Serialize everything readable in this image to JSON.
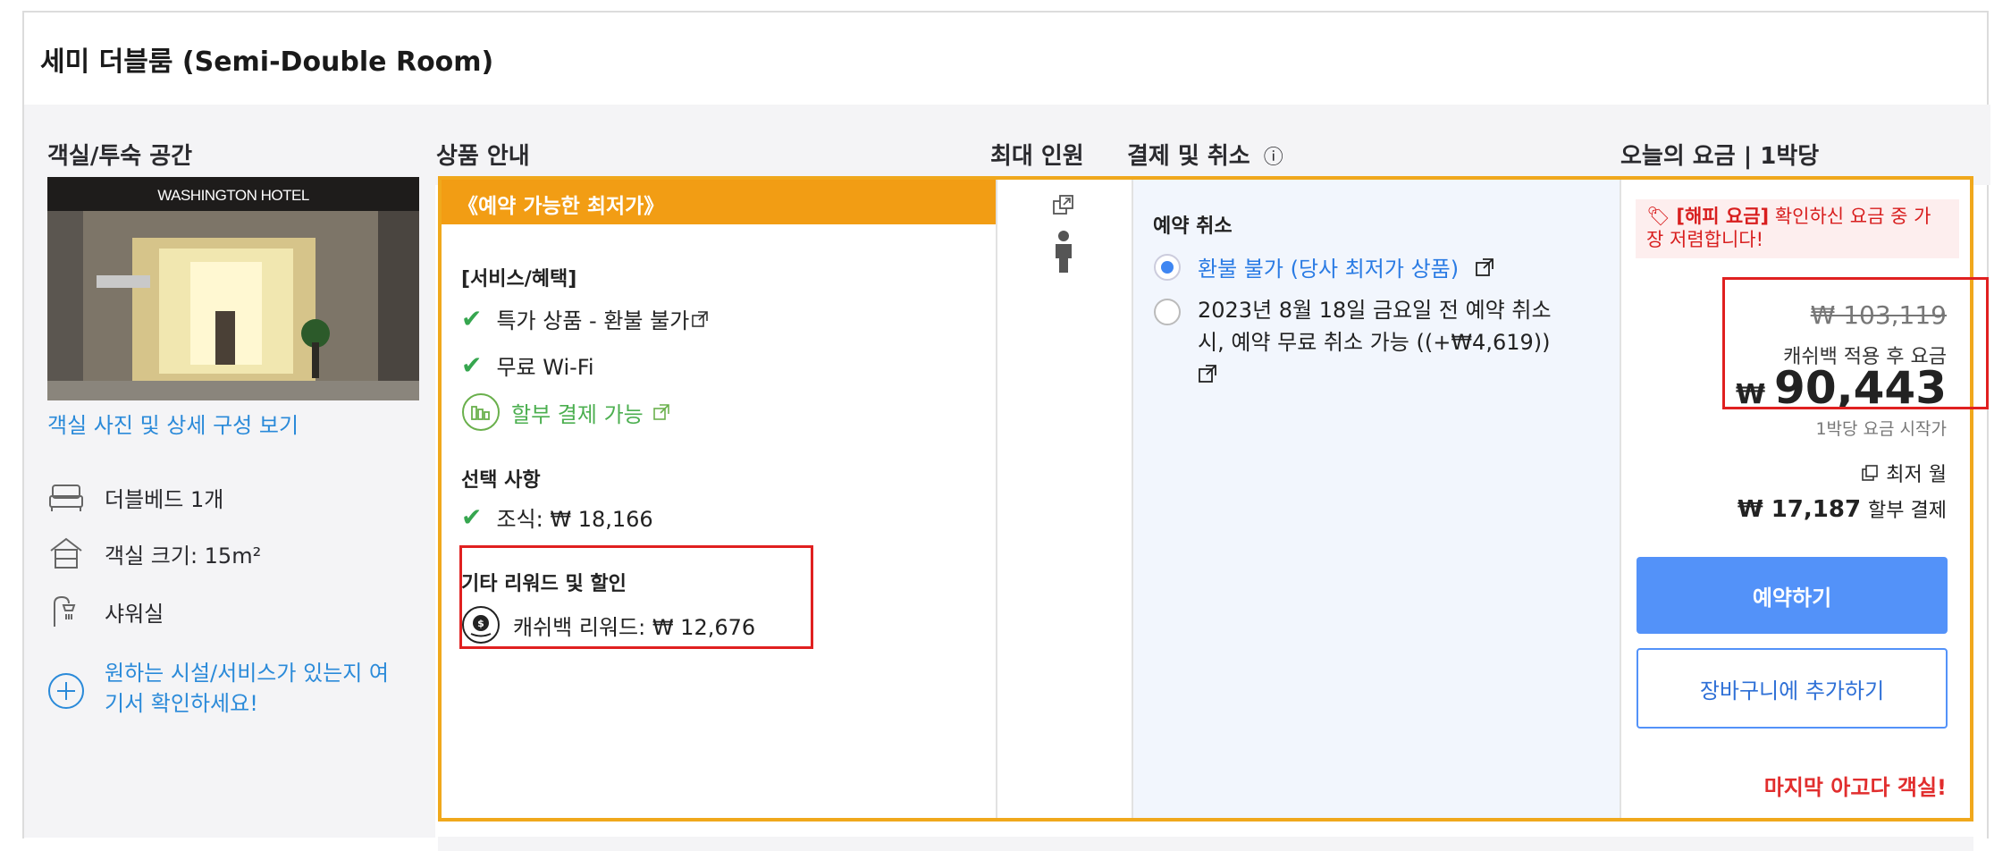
{
  "room": {
    "title": "세미 더블룸 (Semi-Double Room)"
  },
  "headers": {
    "room_space": "객실/투숙 공간",
    "product_info": "상품 안내",
    "max_occupancy": "최대 인원",
    "payment_cancel": "결제 및 취소",
    "info_symbol": "ⓘ",
    "today_price": "오늘의 요금 | 1박당"
  },
  "photo": {
    "hotel_sign": "WASHINGTON HOTEL"
  },
  "room_details": {
    "photo_link": "객실 사진 및 상세 구성 보기",
    "amenities": [
      {
        "icon": "bed-icon",
        "label": "더블베드 1개"
      },
      {
        "icon": "house-icon",
        "label": "객실 크기: 15m²"
      },
      {
        "icon": "shower-icon",
        "label": "샤워실"
      }
    ],
    "facility_link": "원하는 시설/서비스가 있는지 여기서 확인하세요!",
    "facility_link_lines": [
      "원하는 시설/서비스가 있는지 여",
      "기서 확인하세요!"
    ]
  },
  "offer": {
    "banner": "《예약 가능한 최저가》",
    "services_title": "[서비스/혜택]",
    "services": [
      "특가 상품 - 환불 불가",
      "무료 Wi-Fi"
    ],
    "installment": "할부 결제 가능",
    "options_title": "선택 사항",
    "breakfast": "조식: ₩ 18,166",
    "rewards_title": "기타 리워드 및 할인",
    "cashback": "캐쉬백 리워드: ₩ 12,676"
  },
  "cancellation": {
    "title": "예약 취소",
    "options": [
      {
        "label": "환불 불가 (당사 최저가 상품)",
        "selected": true
      },
      {
        "label": "2023년 8월 18일 금요일 전 예약 취소 시, 예약 무료 취소 가능 ((+₩4,619))",
        "selected": false
      }
    ],
    "option2_lines": [
      "2023년 8월 18일 금요일 전 예약 취소",
      "시, 예약 무료 취소 가능 ((+₩4,619))"
    ]
  },
  "pricing": {
    "happy_tag": "[해피 요금]",
    "happy_text": "확인하신 요금 중 가장 저렴합니다!",
    "happy_line1_rest": " 확인하신 요금 중 가",
    "happy_line2": "장 저렴합니다!",
    "original": "₩ 103,119",
    "cashback_note": "캐쉬백 적용 후 요금",
    "currency": "₩",
    "final": "90,443",
    "start_note": "1박당 요금 시작가",
    "min_month": "최저 월",
    "installment_amount": "₩ 17,187",
    "installment_label": "할부 결제",
    "book_button": "예약하기",
    "cart_button": "장바구니에 추가하기",
    "last_room": "마지막 아고다 객실!"
  },
  "colors": {
    "accent": "#f29d14",
    "primary": "#5392f9",
    "link": "#2a8ad9",
    "success": "#36a64f",
    "alert": "#e02020"
  }
}
